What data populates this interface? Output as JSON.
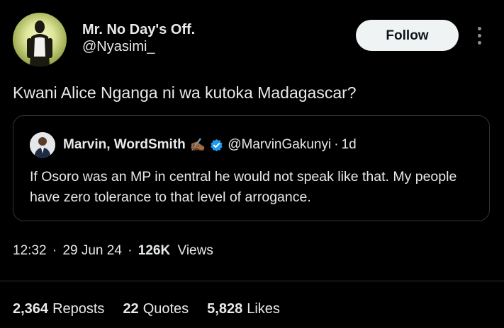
{
  "author": {
    "name": "Mr. No Day's Off.",
    "handle": "@Nyasimi_"
  },
  "follow_button": {
    "label": "Follow"
  },
  "more_button": {
    "icon": "more-vertical-icon"
  },
  "tweet": {
    "text": "Kwani Alice Nganga ni wa kutoka Madagascar?"
  },
  "quoted_tweet": {
    "author_name": "Marvin, WordSmith",
    "emoji": "✍🏾",
    "verified_icon": "verified-badge-icon",
    "handle": "@MarvinGakunyi",
    "separator": "·",
    "time": "1d",
    "text": "If Osoro was an MP in central he would not speak like that. My people have zero tolerance to that level of arrogance."
  },
  "meta": {
    "time": "12:32",
    "sep1": "·",
    "date": "29 Jun 24",
    "sep2": "·",
    "views_count": "126K",
    "views_label": "Views"
  },
  "stats": [
    {
      "value": "2,364",
      "label": "Reposts"
    },
    {
      "value": "22",
      "label": "Quotes"
    },
    {
      "value": "5,828",
      "label": "Likes"
    }
  ],
  "colors": {
    "background": "#000000",
    "text": "#e7e9ea",
    "border": "#2f3336",
    "follow_bg": "#eff3f4",
    "verified": "#1d9bf0"
  }
}
